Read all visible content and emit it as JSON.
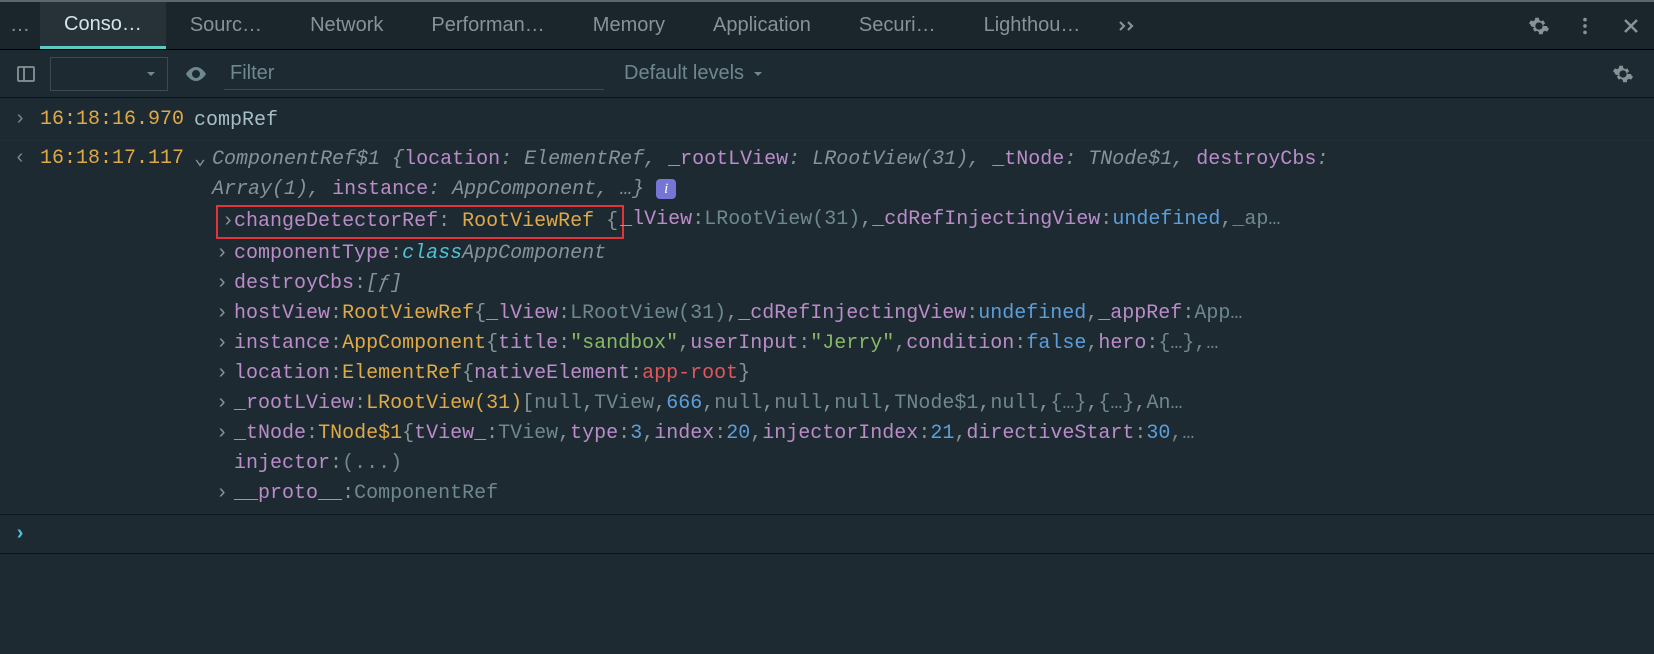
{
  "tabs": {
    "overflow_left": "…",
    "console": "Conso…",
    "sources": "Sourc…",
    "network": "Network",
    "performance": "Performan…",
    "memory": "Memory",
    "application": "Application",
    "security": "Securi…",
    "lighthouse": "Lighthou…"
  },
  "filterbar": {
    "filter_placeholder": "Filter",
    "levels_label": "Default levels"
  },
  "log1": {
    "timestamp": "16:18:16.970",
    "text": "compRef"
  },
  "log2": {
    "timestamp": "16:18:17.117",
    "header_pre": "ComponentRef$1 {",
    "header_loc_k": "location",
    "header_loc_v": "ElementRef",
    "header_root_k": "_rootLView",
    "header_root_v": "LRootView(31)",
    "header_tnode_k": "_tNode",
    "header_tnode_v": "TNode$1",
    "header_dcb_k": "destroyCbs",
    "header_dcb_v": "Array(1)",
    "header_inst_k": "instance",
    "header_inst_v": "AppComponent",
    "header_end": ", …}",
    "p1_key": "changeDetectorRef",
    "p1_type": "RootViewRef",
    "p1_lv_k": "_lView",
    "p1_lv_v": "LRootView(31)",
    "p1_cd_k": "_cdRefInjectingView",
    "p1_cd_v": "undefined",
    "p1_tail": "_ap…",
    "p2_key": "componentType",
    "p2_class_kw": "class",
    "p2_class_name": "AppComponent",
    "p3_key": "destroyCbs",
    "p3_val": "[ƒ]",
    "p4_key": "hostView",
    "p4_type": "RootViewRef",
    "p4_lv_k": "_lView",
    "p4_lv_v": "LRootView(31)",
    "p4_cd_k": "_cdRefInjectingView",
    "p4_cd_v": "undefined",
    "p4_app_k": "_appRef",
    "p4_app_v": "App…",
    "p5_key": "instance",
    "p5_type": "AppComponent",
    "p5_title_k": "title",
    "p5_title_v": "\"sandbox\"",
    "p5_ui_k": "userInput",
    "p5_ui_v": "\"Jerry\"",
    "p5_cond_k": "condition",
    "p5_cond_v": "false",
    "p5_hero_k": "hero",
    "p5_hero_v": "{…}",
    "p5_tail": ",…",
    "p6_key": "location",
    "p6_type": "ElementRef",
    "p6_ne_k": "nativeElement",
    "p6_ne_v": "app-root",
    "p7_key": "_rootLView",
    "p7_type": "LRootView(31)",
    "p7_items_a": "null",
    "p7_items_b": "TView",
    "p7_items_c": "666",
    "p7_items_d": "null",
    "p7_items_e": "null",
    "p7_items_f": "null",
    "p7_items_g": "TNode$1",
    "p7_items_h": "null",
    "p7_items_i": "{…}",
    "p7_items_j": "{…}",
    "p7_tail": "An…",
    "p8_key": "_tNode",
    "p8_type": "TNode$1",
    "p8_tv_k": "tView_",
    "p8_tv_v": "TView",
    "p8_type_k": "type",
    "p8_type_v": "3",
    "p8_idx_k": "index",
    "p8_idx_v": "20",
    "p8_inj_k": "injectorIndex",
    "p8_inj_v": "21",
    "p8_ds_k": "directiveStart",
    "p8_ds_v": "30",
    "p8_tail": ",…",
    "p9_key": "injector",
    "p9_val": "(...)",
    "p10_key": "__proto__",
    "p10_val": "ComponentRef"
  }
}
